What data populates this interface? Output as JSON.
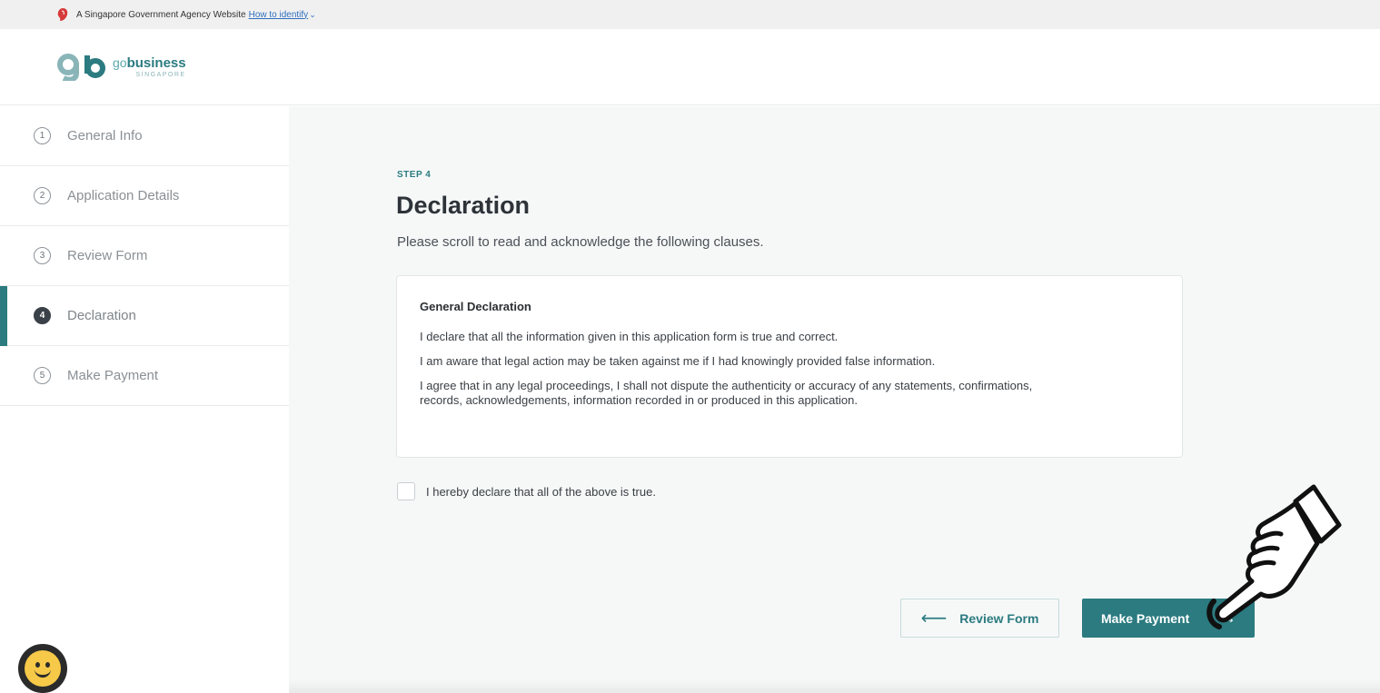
{
  "masthead": {
    "text": "A Singapore Government Agency Website",
    "link": "How to identify"
  },
  "logo": {
    "prefix": "go",
    "name": "business",
    "country": "SINGAPORE"
  },
  "sidebar": {
    "steps": [
      {
        "num": "1",
        "label": "General Info"
      },
      {
        "num": "2",
        "label": "Application Details"
      },
      {
        "num": "3",
        "label": "Review Form"
      },
      {
        "num": "4",
        "label": "Declaration"
      },
      {
        "num": "5",
        "label": "Make Payment"
      }
    ]
  },
  "main": {
    "step_tag": "STEP 4",
    "title": "Declaration",
    "subtitle": "Please scroll to read and acknowledge the following clauses.",
    "declaration": {
      "heading": "General Declaration",
      "clauses": [
        "I declare that all the information given in this application form is true and correct.",
        "I am aware that legal action may be taken against me if I had knowingly provided false information.",
        "I agree that in any legal proceedings, I shall not dispute the authenticity or accuracy of any statements, confirmations, records, acknowledgements, information recorded in or produced in this application."
      ]
    },
    "checkbox_label": "I hereby declare that all of the above is true.",
    "back_button": "Review Form",
    "next_button": "Make Payment"
  },
  "colors": {
    "brand": "#2b7b80",
    "background": "#f6f8f8"
  }
}
